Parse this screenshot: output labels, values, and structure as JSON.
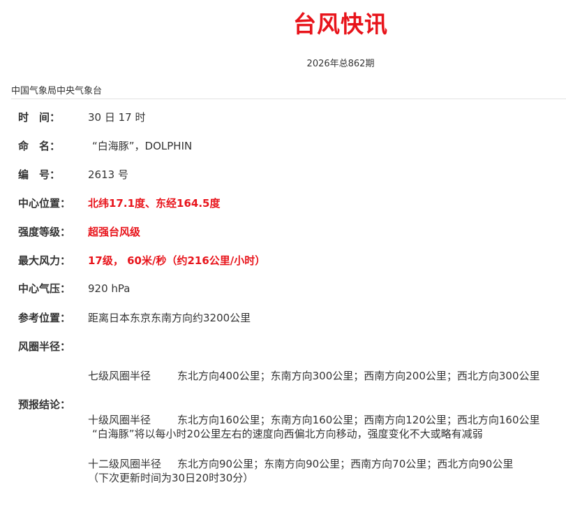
{
  "header": {
    "title": "台风快讯",
    "issue": "2026年总862期",
    "agency": "中国气象局中央气象台"
  },
  "fields": {
    "time": {
      "label": "时　间：",
      "value": "30 日 17 时"
    },
    "name": {
      "label": "命　名：",
      "value": "“白海豚”，DOLPHIN"
    },
    "number": {
      "label": "编　号：",
      "value": "2613 号"
    },
    "center": {
      "label": "中心位置：",
      "value": "北纬17.1度、东经164.5度"
    },
    "intensity": {
      "label": "强度等级：",
      "value": "超强台风级"
    },
    "max_wind": {
      "label": "最大风力：",
      "value": "17级， 60米/秒（约216公里/小时）"
    },
    "pressure": {
      "label": "中心气压：",
      "value": "920 hPa"
    },
    "reference": {
      "label": "参考位置：",
      "value": "距离日本东京东南方向约3200公里"
    },
    "wind_radius": {
      "label": "风圈半径：",
      "lines": [
        {
          "level": "七级风圈半径",
          "detail": "东北方向400公里；东南方向300公里；西南方向200公里；西北方向300公里"
        },
        {
          "level": "十级风圈半径",
          "detail": "东北方向160公里；东南方向160公里；西南方向120公里；西北方向160公里"
        },
        {
          "level": "十二级风圈半径",
          "detail": "东北方向90公里；东南方向90公里；西南方向70公里；西北方向90公里"
        }
      ]
    },
    "forecast": {
      "label": "预报结论：",
      "text": "“白海豚”将以每小时20公里左右的速度向西偏北方向移动，强度变化不大或略有减弱",
      "next_update": "（下次更新时间为30日20时30分）"
    }
  },
  "colors": {
    "accent_red": "#e8141b",
    "text": "#333333",
    "divider": "#e2e2e2"
  }
}
